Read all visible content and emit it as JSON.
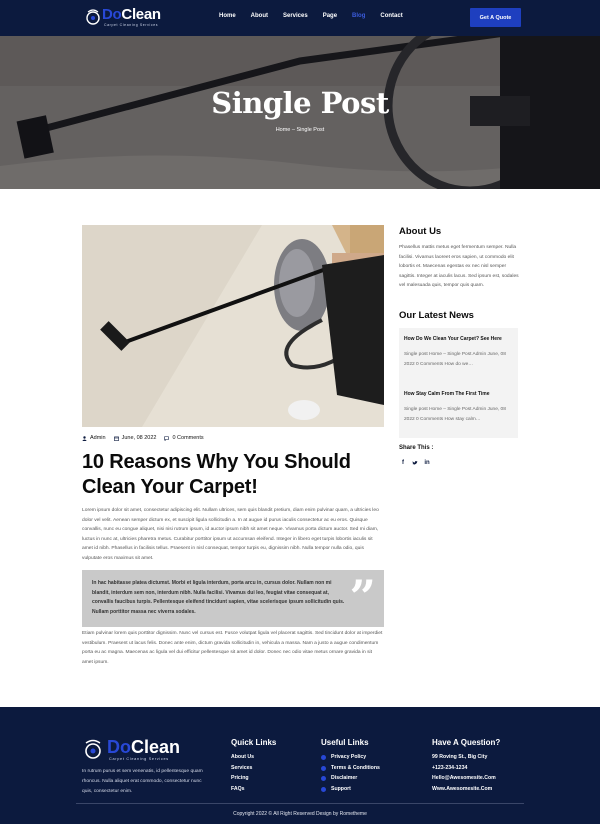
{
  "header": {
    "logo_do": "Do",
    "logo_clean": "Clean",
    "logo_tagline": "Carpet Cleaning Services",
    "nav": [
      {
        "label": "Home",
        "active": false
      },
      {
        "label": "About",
        "active": false
      },
      {
        "label": "Services",
        "active": false
      },
      {
        "label": "Page",
        "active": false
      },
      {
        "label": "Blog",
        "active": true
      },
      {
        "label": "Contact",
        "active": false
      }
    ],
    "cta_label": "Get A Quote"
  },
  "hero": {
    "title": "Single Post",
    "breadcrumb": "Home – Single Post"
  },
  "post": {
    "meta": {
      "author": "Admin",
      "date": "June, 08 2022",
      "comments": "0 Comments"
    },
    "title": "10 Reasons Why You Should Clean Your Carpet!",
    "paragraph1": "Lorem ipsum dolor sit amet, consectetur adipiscing elit. Nullam ultrices, sem quis blandit pretium, diam enim pulvinar quam, a ultricies leo dolor vel velit. Aenean semper dictum ex, et suscipit ligula sollicitudin a. In at augue id purus iaculis consectetur ac eu eros. Quisque convallis, nunc eu congue aliquet, nisi nisi rutrum ipsum, id auctor ipsum nibh sit amet neque. Vivamus porta dictum auctor. Sed mi diam, luctus in nunc at, ultricies pharetra metus. Curabitur porttitor ipsum ut accumsan eleifend. Integer in libero eget turpis lobortis iaculis sit amet id nibh. Phasellus in facilisis tellus. Praesent in nisl consequat, tempor turpis eu, dignissim nibh. Nulla tempor nulla odio, quis vulputate eros maximus sit amet.",
    "quote": "In hac habitasse platea dictumst. Morbi et ligula interdum, porta arcu in, cursus dolor. Nullam non mi blandit, interdum sem non, interdum nibh. Nulla facilisi. Vivamus dui leo, feugiat vitae consequat at, convallis faucibus turpis. Pellentesque eleifend tincidunt sapien, vitae scelerisque ipsum sollicitudin quis. Nullam porttitor massa nec viverra sodales.",
    "paragraph2": "Etiam pulvinar lorem quis porttitor dignissim. Nunc vel cursus est. Fusce volutpat ligula vel placerat sagittis. Sed tincidunt dolor at imperdiet vestibulum. Praesent ut lacus felis. Donec ante enim, dictum gravida sollicitudin in, vehicula a massa. Nam a justo a augue condimentum porta eu ac magna. Maecenas ac ligula vel dui efficitur pellentesque sit amet id dolor. Donec nec odio vitae metus ornare gravida in sit amet ipsum."
  },
  "sidebar": {
    "about_heading": "About Us",
    "about_text": "Phasellus mattis metus eget fermentum semper. Nulla facilisi. Vivamus laoreet eros sapien, ut commodo elit lobortis et. Maecenas egestas ex nec nisl semper sagittis. Integer at iaculis lacus. Sed ipsum est, sodales vel malesuada quis, tempor quis quam.",
    "news_heading": "Our Latest News",
    "news": [
      {
        "title": "How Do We Clean Your Carpet? See Here",
        "excerpt": "Single post Home – Single Post Admin June, 08 2022 0 Comments How do we…"
      },
      {
        "title": "How Stay Calm From The First Time",
        "excerpt": "Single post Home – Single Post Admin June, 08 2022 0 Comments How stay calm…"
      }
    ],
    "share_heading": "Share This :",
    "share_icons": [
      "facebook-icon",
      "twitter-icon",
      "linkedin-icon"
    ]
  },
  "footer": {
    "logo_do": "Do",
    "logo_clean": "Clean",
    "logo_tagline": "Carpet Cleaning Services",
    "about_text": "In rutrum purus et sem venenatis, id pellentesque quam rhoncus. Nulla aliquet erat commodo, consectetur nunc quis, consectetur enim.",
    "quick_links_heading": "Quick Links",
    "quick_links": [
      "About Us",
      "Services",
      "Pricing",
      "FAQs"
    ],
    "useful_links_heading": "Useful Links",
    "useful_links": [
      "Privacy Policy",
      "Terms & Conditions",
      "Disclaimer",
      "Support"
    ],
    "question_heading": "Have A Question?",
    "contact": [
      "99 Roving St., Big City",
      "+123-234-1234",
      "Hello@Awesomesite.Com",
      "Www.Awesomesite.Com"
    ],
    "copyright": "Copyright 2022 © All Right Reserved Design by Rometheme"
  },
  "colors": {
    "navy": "#0c1a3e",
    "accent_blue": "#1e3fbf",
    "quote_bg": "#c9c9c9"
  }
}
